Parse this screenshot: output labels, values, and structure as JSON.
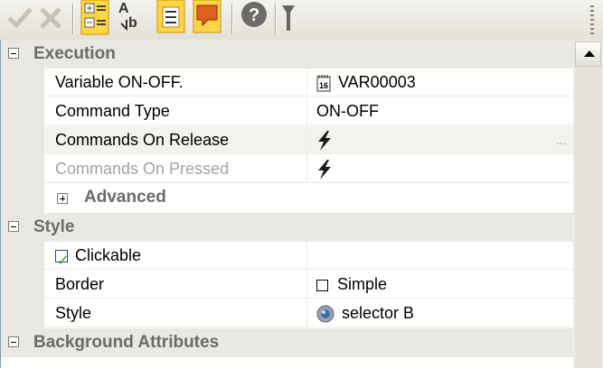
{
  "toolbar": {
    "buttons": [
      "apply-icon",
      "cancel-icon",
      "categorized-icon",
      "alphabetical-icon",
      "property-pages-icon",
      "comments-icon",
      "help-icon",
      "filter-icon"
    ]
  },
  "categories": {
    "execution": "Execution",
    "advanced": "Advanced",
    "style": "Style",
    "background": "Background Attributes"
  },
  "props": {
    "variable_onoff": {
      "name": "Variable ON-OFF.",
      "value": "VAR00003"
    },
    "command_type": {
      "name": "Command Type",
      "value": "ON-OFF"
    },
    "commands_release": {
      "name": "Commands On Release",
      "value": "",
      "ellipsis": "..."
    },
    "commands_pressed": {
      "name": "Commands On Pressed",
      "value": ""
    },
    "clickable": {
      "name": "Clickable",
      "checked": true
    },
    "border": {
      "name": "Border",
      "value": "Simple"
    },
    "style": {
      "name": "Style",
      "value": "selector B"
    }
  },
  "colors": {
    "category_bg": "#eae8e2",
    "disabled_text": "#a3a3a3",
    "bolt": "#1a1a1a"
  }
}
